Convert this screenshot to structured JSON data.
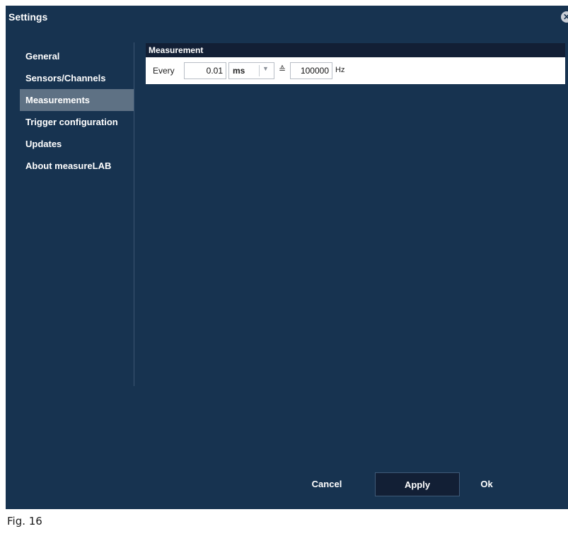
{
  "window": {
    "title": "Settings",
    "close_icon": "close-icon"
  },
  "sidebar": {
    "items": [
      {
        "label": "General",
        "active": false
      },
      {
        "label": "Sensors/Channels",
        "active": false
      },
      {
        "label": "Measurements",
        "active": true
      },
      {
        "label": "Trigger configuration",
        "active": false
      },
      {
        "label": "Updates",
        "active": false
      },
      {
        "label": "About measureLAB",
        "active": false
      }
    ]
  },
  "panel": {
    "header": "Measurement",
    "every_label": "Every",
    "interval_value": "0.01",
    "unit": "ms",
    "equivalent_symbol": "≙",
    "frequency_value": "100000",
    "frequency_unit": "Hz"
  },
  "footer": {
    "cancel_label": "Cancel",
    "apply_label": "Apply",
    "ok_label": "Ok"
  },
  "caption": "Fig. 16",
  "colors": {
    "background": "#173350",
    "header": "#121f35",
    "active_item": "#5e7184"
  }
}
